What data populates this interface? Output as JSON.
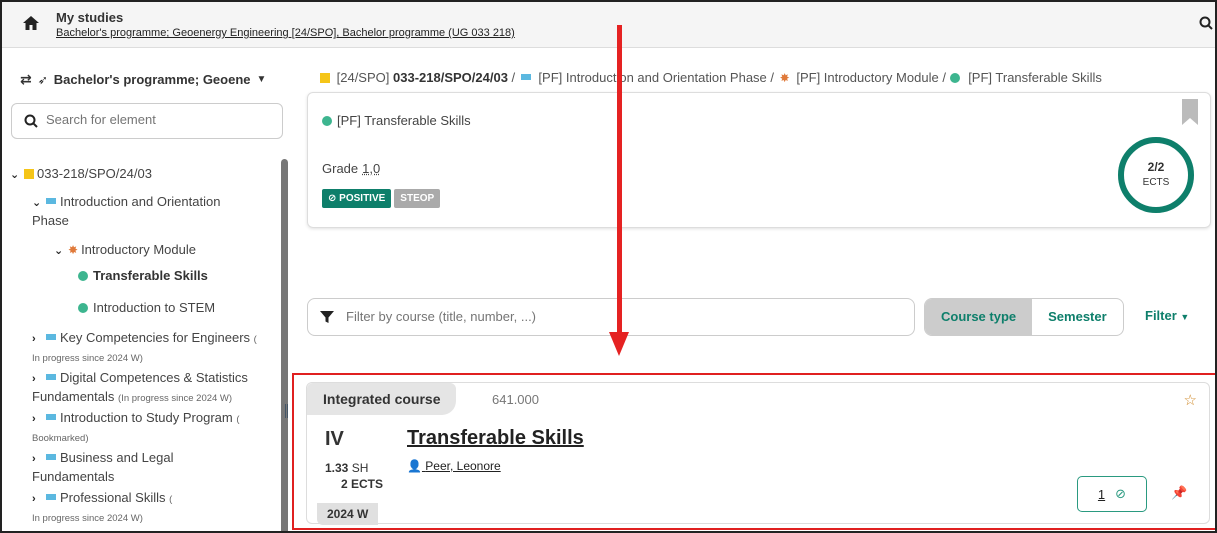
{
  "header": {
    "title": "My studies",
    "subtitle": "Bachelor's programme; Geoenergy Engineering [24/SPO], Bachelor programme (UG 033 218)"
  },
  "sidebar": {
    "program_switch_label": "Bachelor's programme; Geoene",
    "search_placeholder": "Search for element",
    "tree": [
      {
        "label": "033-218/SPO/24/03"
      },
      {
        "label": "Introduction and Orientation",
        "label2": "Phase"
      },
      {
        "label": "Introductory Module"
      },
      {
        "label": "Transferable Skills"
      },
      {
        "label": "Introduction to STEM"
      },
      {
        "label": "Key Competencies for Engineers",
        "suffix": "(",
        "note": "In progress since 2024 W)"
      },
      {
        "label": "Digital Competences & Statistics",
        "label2": "Fundamentals",
        "note": "(In progress since 2024 W)"
      },
      {
        "label": "Introduction to Study Program",
        "suffix": "(",
        "note": "Bookmarked)"
      },
      {
        "label": "Business and Legal",
        "label2": "Fundamentals"
      },
      {
        "label": "Professional Skills",
        "suffix": "(",
        "note": "In progress since 2024 W)"
      }
    ]
  },
  "breadcrumb": {
    "item1_prefix": "[24/SPO]",
    "item1": "033-218/SPO/24/03",
    "sep": "/",
    "item2": "[PF] Introduction and Orientation Phase",
    "item3": "[PF] Introductory Module",
    "item4": "[PF] Transferable Skills"
  },
  "summary_card": {
    "title": "[PF] Transferable Skills",
    "grade_label": "Grade",
    "grade_value": "1,0",
    "badge_positive": "POSITIVE",
    "badge_steop": "STEOP",
    "ects_value": "2/2",
    "ects_unit": "ECTS",
    "ects_progress": 1.0
  },
  "filter": {
    "placeholder": "Filter by course (title, number, ...)",
    "seg_course_type": "Course type",
    "seg_semester": "Semester",
    "filter_dropdown": "Filter"
  },
  "course": {
    "type": "Integrated course",
    "number": "641.000",
    "abbr": "IV",
    "title": "Transferable Skills",
    "sh_value": "1.33",
    "sh_unit": "SH",
    "ects": "2 ECTS",
    "lecturer": "Peer, Leonore",
    "semester": "2024 W",
    "attempts": "1"
  },
  "colors": {
    "accent": "#0e7f6b",
    "highlight": "#e02020",
    "folder": "#f5c518",
    "module_flag": "#5bb8e0",
    "leaf_dot": "#3db58f"
  }
}
